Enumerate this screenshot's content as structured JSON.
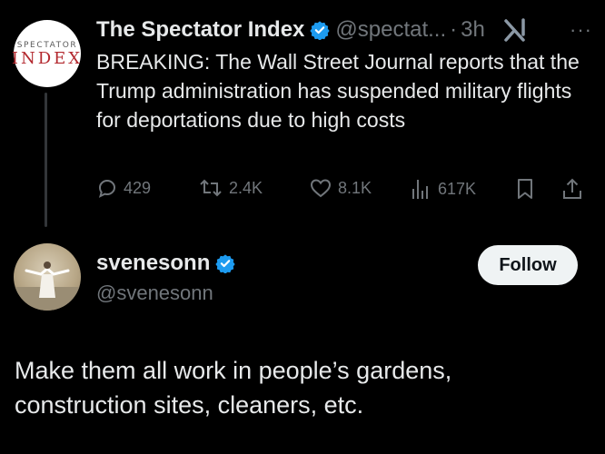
{
  "original_tweet": {
    "avatar": {
      "line1": "SPECTATOR",
      "line2": "INDEX"
    },
    "display_name": "The Spectator Index",
    "handle": "@spectat...",
    "separator": "·",
    "time": "3h",
    "more": "···",
    "text": "BREAKING: The Wall Street Journal reports that the Trump administration has suspended military flights for deportations due to high costs",
    "actions": {
      "replies": "429",
      "reposts": "2.4K",
      "likes": "8.1K",
      "views": "617K"
    }
  },
  "reply": {
    "display_name": "svenesonn",
    "handle": "@svenesonn",
    "follow_label": "Follow",
    "text": "Make them all work in people’s gardens, construction sites, cleaners, etc."
  },
  "colors": {
    "background": "#000000",
    "text": "#e7e9ea",
    "muted": "#71767b",
    "verified": "#1d9bf0"
  },
  "icons": [
    "verified-badge-icon",
    "grok-icon",
    "more-icon",
    "reply-icon",
    "repost-icon",
    "like-icon",
    "views-icon",
    "bookmark-icon",
    "share-icon"
  ]
}
